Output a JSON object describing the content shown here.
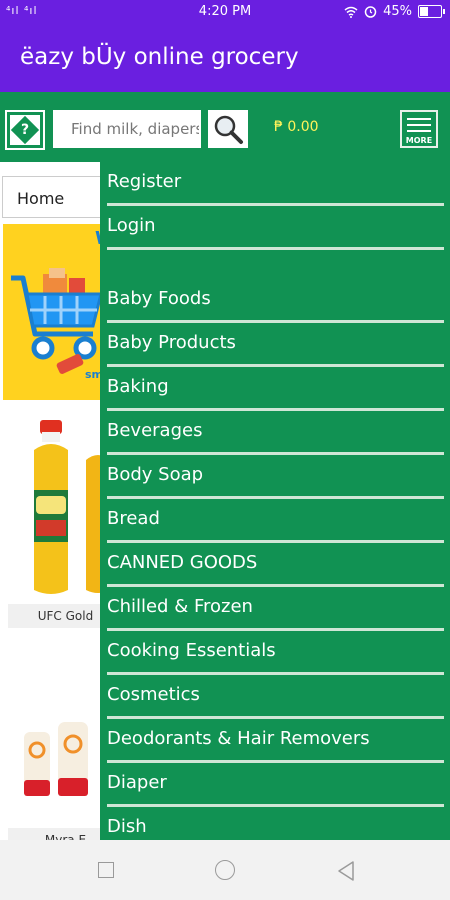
{
  "status_bar": {
    "signal": "⁴ıl ⁴ıl",
    "time": "4:20 PM",
    "battery_text": "45%",
    "battery_level": 0.45
  },
  "app": {
    "title": "ëazy bÜy online grocery",
    "brand_color": "#6a1fe0",
    "accent_color": "#119253"
  },
  "toolbar": {
    "help_icon_glyph": "?",
    "search_placeholder": "Find milk, diapers",
    "price": "₱ 0.00",
    "more_label": "MORE"
  },
  "content": {
    "dropdown_value": "Home",
    "banner_letter": "W",
    "banner_text": "sm\ngl",
    "products": [
      {
        "caption": "UFC Gold",
        "image": "oil-bottle-icon"
      },
      {
        "caption": "Myra E",
        "image": "lotion-bottle-icon"
      }
    ]
  },
  "drawer": {
    "account_items": [
      {
        "label": "Register"
      },
      {
        "label": "Login"
      }
    ],
    "category_items": [
      {
        "label": "Baby Foods"
      },
      {
        "label": "Baby Products"
      },
      {
        "label": "Baking"
      },
      {
        "label": "Beverages"
      },
      {
        "label": "Body Soap"
      },
      {
        "label": "Bread"
      },
      {
        "label": "CANNED GOODS"
      },
      {
        "label": "Chilled & Frozen"
      },
      {
        "label": "Cooking Essentials"
      },
      {
        "label": "Cosmetics"
      },
      {
        "label": "Deodorants & Hair Removers"
      },
      {
        "label": "Diaper"
      },
      {
        "label": "Dish"
      }
    ]
  },
  "nav_bar": {
    "icons": [
      "recents-square-icon",
      "home-circle-icon",
      "back-triangle-icon"
    ]
  }
}
